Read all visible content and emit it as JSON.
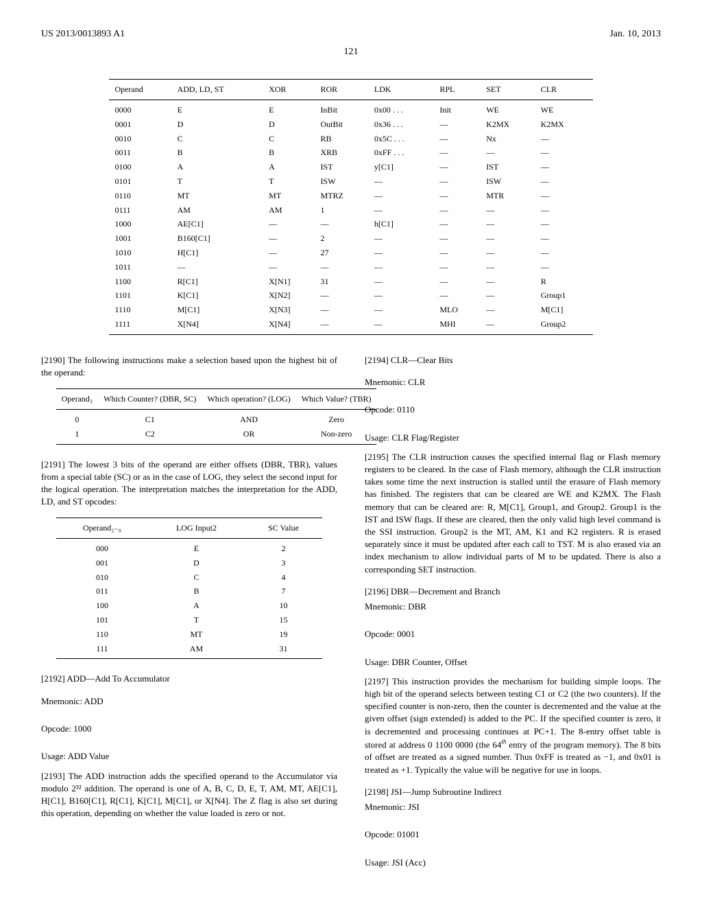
{
  "header": {
    "left": "US 2013/0013893 A1",
    "right": "Jan. 10, 2013",
    "page": "121"
  },
  "chart_data": [
    {
      "type": "table",
      "title": "Operand encodings",
      "columns": [
        "Operand",
        "ADD, LD, ST",
        "XOR",
        "ROR",
        "LDK",
        "RPL",
        "SET",
        "CLR"
      ],
      "rows": [
        [
          "0000",
          "E",
          "E",
          "InBit",
          "0x00 . . .",
          "Init",
          "WE",
          "WE"
        ],
        [
          "0001",
          "D",
          "D",
          "OutBit",
          "0x36 . . .",
          "—",
          "K2MX",
          "K2MX"
        ],
        [
          "0010",
          "C",
          "C",
          "RB",
          "0x5C . . .",
          "—",
          "Nx",
          "—"
        ],
        [
          "0011",
          "B",
          "B",
          "XRB",
          "0xFF . . .",
          "—",
          "—",
          "—"
        ],
        [
          "0100",
          "A",
          "A",
          "IST",
          "y[C1]",
          "—",
          "IST",
          "—"
        ],
        [
          "0101",
          "T",
          "T",
          "ISW",
          "—",
          "—",
          "ISW",
          "—"
        ],
        [
          "0110",
          "MT",
          "MT",
          "MTRZ",
          "—",
          "—",
          "MTR",
          "—"
        ],
        [
          "0111",
          "AM",
          "AM",
          "1",
          "—",
          "—",
          "—",
          "—"
        ],
        [
          "1000",
          "AE[C1]",
          "—",
          "—",
          "h[C1]",
          "—",
          "—",
          "—"
        ],
        [
          "1001",
          "B160[C1]",
          "—",
          "2",
          "—",
          "—",
          "—",
          "—"
        ],
        [
          "1010",
          "H[C1]",
          "—",
          "27",
          "—",
          "—",
          "—",
          "—"
        ],
        [
          "1011",
          "—",
          "—",
          "—",
          "—",
          "—",
          "—",
          "—"
        ],
        [
          "1100",
          "R[C1]",
          "X[N1]",
          "31",
          "—",
          "—",
          "—",
          "R"
        ],
        [
          "1101",
          "K[C1]",
          "X[N2]",
          "—",
          "—",
          "—",
          "—",
          "Group1"
        ],
        [
          "1110",
          "M[C1]",
          "X[N3]",
          "—",
          "—",
          "MLO",
          "—",
          "M[C1]"
        ],
        [
          "1111",
          "X[N4]",
          "X[N4]",
          "—",
          "—",
          "MHI",
          "—",
          "Group2"
        ]
      ]
    },
    {
      "type": "table",
      "title": "Operand3 selection",
      "columns": [
        "Operand₃",
        "Which Counter? (DBR, SC)",
        "Which operation? (LOG)",
        "Which Value? (TBR)"
      ],
      "rows": [
        [
          "0",
          "C1",
          "AND",
          "Zero"
        ],
        [
          "1",
          "C2",
          "OR",
          "Non-zero"
        ]
      ]
    },
    {
      "type": "table",
      "title": "Operand2-0 mapping",
      "columns": [
        "Operand₂₋₀",
        "LOG Input2",
        "SC Value"
      ],
      "rows": [
        [
          "000",
          "E",
          "2"
        ],
        [
          "001",
          "D",
          "3"
        ],
        [
          "010",
          "C",
          "4"
        ],
        [
          "011",
          "B",
          "7"
        ],
        [
          "100",
          "A",
          "10"
        ],
        [
          "101",
          "T",
          "15"
        ],
        [
          "110",
          "MT",
          "19"
        ],
        [
          "111",
          "AM",
          "31"
        ]
      ]
    }
  ],
  "left": {
    "p2190": "[2190]   The following instructions make a selection based upon the highest bit of the operand:",
    "p2191": "[2191]   The lowest 3 bits of the operand are either offsets (DBR, TBR), values from a special table (SC) or as in the case of LOG, they select the second input for the logical operation. The interpretation matches the interpretation for the ADD, LD, and ST opcodes:",
    "p2192": "[2192]   ADD—Add To Accumulator",
    "add_mn": "Mnemonic: ADD",
    "add_op": "Opcode: 1000",
    "add_us": "Usage: ADD Value",
    "p2193": "[2193]   The ADD instruction adds the specified operand to the Accumulator via modulo 2³² addition. The operand is one of A, B, C, D, E, T, AM, MT, AE[C1], H[C1], B160[C1], R[C1], K[C1], M[C1], or X[N4]. The Z flag is also set during this operation, depending on whether the value loaded is zero or not."
  },
  "right": {
    "p2194": "[2194]   CLR—Clear Bits",
    "clr_mn": "Mnemonic: CLR",
    "clr_op": "Opcode: 0110",
    "clr_us": "Usage: CLR Flag/Register",
    "p2195": "[2195]   The CLR instruction causes the specified internal flag or Flash memory registers to be cleared. In the case of Flash memory, although the CLR instruction takes some time the next instruction is stalled until the erasure of Flash memory has finished. The registers that can be cleared are WE and K2MX. The Flash memory that can be cleared are: R, M[C1], Group1, and Group2. Group1 is the IST and ISW flags. If these are cleared, then the only valid high level command is the SSI instruction. Group2 is the MT, AM, K1 and K2 registers. R is erased separately since it must be updated after each call to TST. M is also erased via an index mechanism to allow individual parts of M to be updated. There is also a corresponding SET instruction.",
    "p2196": "[2196]   DBR—Decrement and Branch",
    "dbr_mn": "Mnemonic: DBR",
    "dbr_op": "Opcode: 0001",
    "dbr_us": "Usage: DBR Counter, Offset",
    "p2197_a": "[2197]   This instruction provides the mechanism for building simple loops. The high bit of the operand selects between testing C1 or C2 (the two counters). If the specified counter is non-zero, then the counter is decremented and the value at the given offset (sign extended) is added to the PC. If the specified counter is zero, it is decremented and processing continues at PC+1. The 8-entry offset table is stored at address 0 1100 0000 (the 64",
    "p2197_b": " entry of the program memory). The 8 bits of offset are treated as a signed number. Thus 0xFF is treated as −1, and 0x01 is treated as +1. Typically the value will be negative for use in loops.",
    "p2197_th": "th",
    "p2198": "[2198]   JSI—Jump Subroutine Indirect",
    "jsi_mn": "Mnemonic: JSI",
    "jsi_op": "Opcode: 01001",
    "jsi_us": "Usage: JSI (Acc)"
  }
}
